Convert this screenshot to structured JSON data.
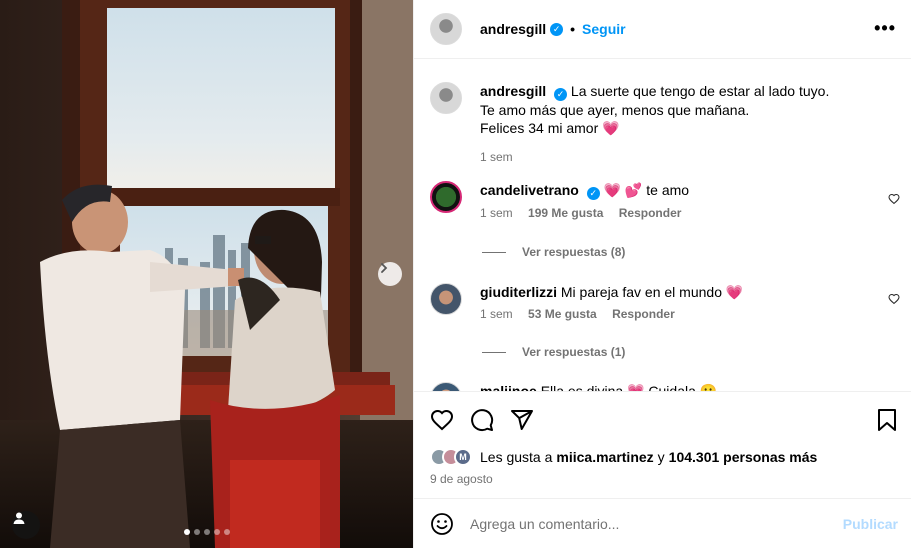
{
  "post": {
    "author": "andresgill",
    "follow_label": "Seguir",
    "more_icon": "more-horizontal-icon"
  },
  "caption": {
    "author": "andresgill",
    "line1": "La suerte que tengo de estar al lado tuyo.",
    "line2": "Te amo más que ayer, menos que mañana.",
    "line3": "Felices 34 mi amor",
    "line3_emoji": "💗",
    "time": "1 sem"
  },
  "comments": [
    {
      "user": "candelivetrano",
      "verified": true,
      "emoji": "💗 💕",
      "text": "te amo",
      "time": "1 sem",
      "likes": "199 Me gusta",
      "reply_label": "Responder",
      "view_replies": "Ver respuestas (8)"
    },
    {
      "user": "giuditerlizzi",
      "verified": false,
      "text": "Mi pareja fav en el mundo",
      "emoji": "💗",
      "time": "1 sem",
      "likes": "53 Me gusta",
      "reply_label": "Responder",
      "view_replies": "Ver respuestas (1)"
    },
    {
      "user": "malijnoe",
      "text": "Ella es divina",
      "emoji": "💗 Cuidala 🙂"
    }
  ],
  "likes": {
    "prefix": "Les gusta a",
    "user": "miica.martinez",
    "connector": "y",
    "others": "104.301 personas más"
  },
  "date": "9 de agosto",
  "composer": {
    "placeholder": "Agrega un comentario...",
    "publish_label": "Publicar"
  },
  "carousel": {
    "total": 5,
    "active": 1
  },
  "colors": {
    "accent": "#0095f6",
    "muted": "#737373",
    "publish_disabled": "#b3dbff",
    "heart": "#f0366c"
  }
}
